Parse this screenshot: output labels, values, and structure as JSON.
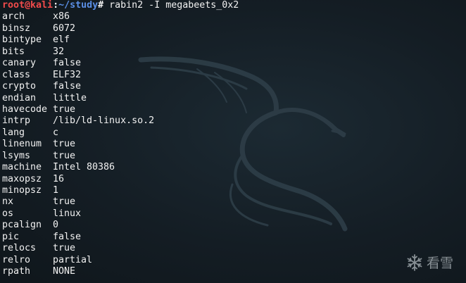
{
  "prompt": {
    "user_host": "root@kali",
    "separator": ":",
    "path": "~/study",
    "symbol": "#",
    "command": " rabin2 -I megabeets_0x2"
  },
  "rows": [
    {
      "key": "arch",
      "value": "x86"
    },
    {
      "key": "binsz",
      "value": "6072"
    },
    {
      "key": "bintype",
      "value": "elf"
    },
    {
      "key": "bits",
      "value": "32"
    },
    {
      "key": "canary",
      "value": "false"
    },
    {
      "key": "class",
      "value": "ELF32"
    },
    {
      "key": "crypto",
      "value": "false"
    },
    {
      "key": "endian",
      "value": "little"
    },
    {
      "key": "havecode",
      "value": "true"
    },
    {
      "key": "intrp",
      "value": "/lib/ld-linux.so.2"
    },
    {
      "key": "lang",
      "value": "c"
    },
    {
      "key": "linenum",
      "value": "true"
    },
    {
      "key": "lsyms",
      "value": "true"
    },
    {
      "key": "machine",
      "value": "Intel 80386"
    },
    {
      "key": "maxopsz",
      "value": "16"
    },
    {
      "key": "minopsz",
      "value": "1"
    },
    {
      "key": "nx",
      "value": "true"
    },
    {
      "key": "os",
      "value": "linux"
    },
    {
      "key": "pcalign",
      "value": "0"
    },
    {
      "key": "pic",
      "value": "false"
    },
    {
      "key": "relocs",
      "value": "true"
    },
    {
      "key": "relro",
      "value": "partial"
    },
    {
      "key": "rpath",
      "value": "NONE"
    }
  ],
  "watermark": {
    "text": "看雪",
    "icon": "snowflake-icon"
  },
  "colors": {
    "background": "#141d24",
    "prompt_user": "#f24b4b",
    "prompt_path": "#5b8fe6",
    "text": "#f2f2f2"
  }
}
